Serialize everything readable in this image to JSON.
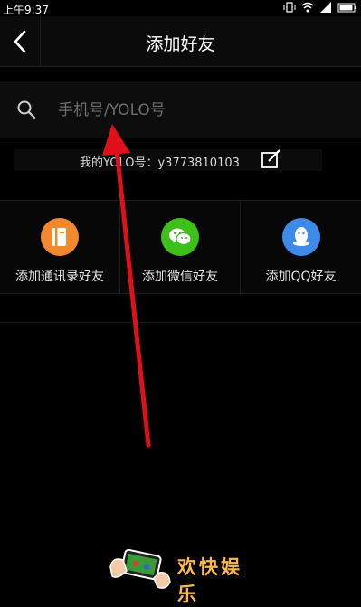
{
  "status_bar": {
    "time": "上午9:37"
  },
  "header": {
    "title": "添加好友"
  },
  "search": {
    "placeholder": "手机号/YOLO号"
  },
  "my_id": {
    "text": "我的YOLO号：y3773810103"
  },
  "shortcuts": [
    {
      "label": "添加通讯录好友",
      "color": "#f08a2c",
      "icon": "contacts-book-icon"
    },
    {
      "label": "添加微信好友",
      "color": "#3ec01a",
      "icon": "wechat-icon"
    },
    {
      "label": "添加QQ好友",
      "color": "#3d8be8",
      "icon": "qq-penguin-icon"
    }
  ],
  "watermark": {
    "text": "欢快娱乐"
  },
  "colors": {
    "annotation_arrow": "#e0101a"
  }
}
